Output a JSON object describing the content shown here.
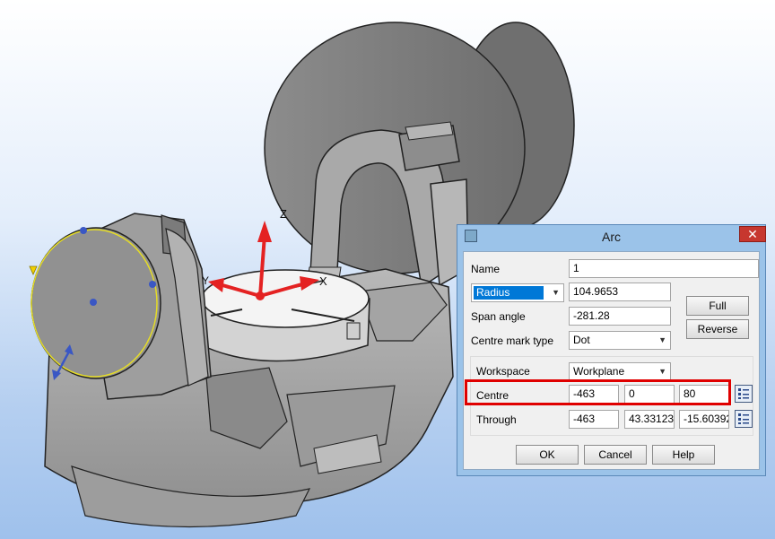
{
  "viewport": {
    "axis_z": "Z",
    "axis_x": "X",
    "axis_y": "Y",
    "colors": {
      "axis": "#e42222",
      "machine": "#aaaaaa",
      "selection": "#e5dc26",
      "handle": "#3a57c4"
    }
  },
  "dialog": {
    "title": "Arc",
    "close_label": "✕",
    "name_label": "Name",
    "name_value": "1",
    "radius_option": "Radius",
    "radius_value": "104.9653",
    "span_label": "Span angle",
    "span_value": "-281.28",
    "centre_mark_label": "Centre mark type",
    "centre_mark_value": "Dot",
    "full_label": "Full",
    "reverse_label": "Reverse",
    "workspace_label": "Workspace",
    "workspace_value": "Workplane",
    "centre_label": "Centre",
    "centre_x": "-463",
    "centre_y": "0",
    "centre_z": "80",
    "through_label": "Through",
    "through_x": "-463",
    "through_y": "43.33123",
    "through_z": "-15.60392",
    "ok_label": "OK",
    "cancel_label": "Cancel",
    "help_label": "Help",
    "accent": "#0078d7",
    "highlight_color": "#e00000"
  }
}
